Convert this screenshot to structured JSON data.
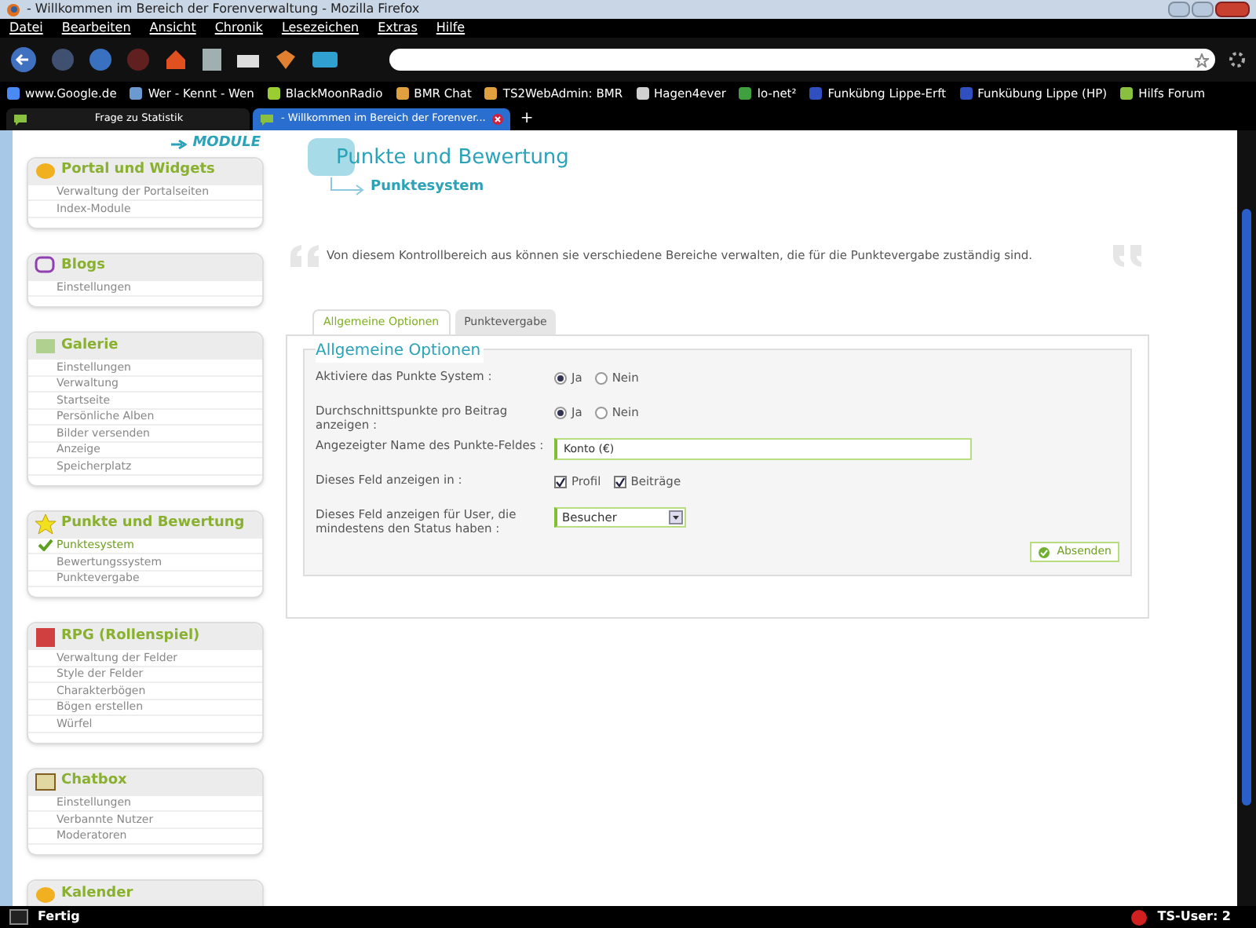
{
  "window": {
    "title": "- Willkommen im Bereich der Forenverwaltung - Mozilla Firefox"
  },
  "menu": [
    "Datei",
    "Bearbeiten",
    "Ansicht",
    "Chronik",
    "Lesezeichen",
    "Extras",
    "Hilfe"
  ],
  "bookmarks": [
    {
      "label": "www.Google.de",
      "color": "#4a8af4"
    },
    {
      "label": "Wer - Kennt - Wen",
      "color": "#6a9ad0"
    },
    {
      "label": "BlackMoonRadio",
      "color": "#9acd32"
    },
    {
      "label": "BMR Chat",
      "color": "#e0a040"
    },
    {
      "label": "TS2WebAdmin: BMR",
      "color": "#e0a040"
    },
    {
      "label": "Hagen4ever",
      "color": "#d0d0d0"
    },
    {
      "label": "lo-net²",
      "color": "#40a040"
    },
    {
      "label": "Funkübng Lippe-Erft",
      "color": "#3050c0"
    },
    {
      "label": "Funkübung Lippe (HP)",
      "color": "#3050c0"
    },
    {
      "label": "Hilfs Forum",
      "color": "#8ac040"
    }
  ],
  "tabs": [
    {
      "label": "Frage zu Statistik",
      "selected": false
    },
    {
      "label": "- Willkommen im Bereich der Forenver...",
      "selected": true
    }
  ],
  "new_tab": "+",
  "sidebar": {
    "header": "MODULE",
    "sections": [
      {
        "title": "Portal und Widgets",
        "items": [
          {
            "label": "Verwaltung der Portalseiten",
            "selected": false
          },
          {
            "label": "Index-Module",
            "selected": false
          }
        ]
      },
      {
        "title": "Blogs",
        "items": [
          {
            "label": "Einstellungen",
            "selected": false
          }
        ]
      },
      {
        "title": "Galerie",
        "items": [
          {
            "label": "Einstellungen",
            "selected": false
          },
          {
            "label": "Verwaltung",
            "selected": false
          },
          {
            "label": "Startseite",
            "selected": false
          },
          {
            "label": "Persönliche Alben",
            "selected": false
          },
          {
            "label": "Bilder versenden",
            "selected": false
          },
          {
            "label": "Anzeige",
            "selected": false
          },
          {
            "label": "Speicherplatz",
            "selected": false
          }
        ]
      },
      {
        "title": "Punkte und Bewertung",
        "items": [
          {
            "label": "Punktesystem",
            "selected": true
          },
          {
            "label": "Bewertungssystem",
            "selected": false
          },
          {
            "label": "Punktevergabe",
            "selected": false
          }
        ]
      },
      {
        "title": "RPG (Rollenspiel)",
        "items": [
          {
            "label": "Verwaltung der Felder",
            "selected": false
          },
          {
            "label": "Style der Felder",
            "selected": false
          },
          {
            "label": "Charakterbögen",
            "selected": false
          },
          {
            "label": "Bögen erstellen",
            "selected": false
          },
          {
            "label": "Würfel",
            "selected": false
          }
        ]
      },
      {
        "title": "Chatbox",
        "items": [
          {
            "label": "Einstellungen",
            "selected": false
          },
          {
            "label": "Verbannte Nutzer",
            "selected": false
          },
          {
            "label": "Moderatoren",
            "selected": false
          }
        ]
      },
      {
        "title": "Kalender"
      }
    ]
  },
  "main": {
    "title": "Punkte und Bewertung",
    "subtitle": "Punktesystem",
    "description": "Von diesem Kontrollbereich aus können sie verschiedene Bereiche verwalten, die für die Punktevergabe zuständig sind.",
    "tabs": [
      {
        "label": "Allgemeine Optionen",
        "selected": true
      },
      {
        "label": "Punktevergabe",
        "selected": false
      }
    ],
    "legend": "Allgemeine Optionen",
    "rows": [
      {
        "kind": "radio",
        "label": "Aktiviere das Punkte System :",
        "options": [
          {
            "label": "Ja",
            "selected": true
          },
          {
            "label": "Nein",
            "selected": false
          }
        ]
      },
      {
        "kind": "radio",
        "label": "Durchschnittspunkte pro Beitrag anzeigen :",
        "options": [
          {
            "label": "Ja",
            "selected": true
          },
          {
            "label": "Nein",
            "selected": false
          }
        ]
      },
      {
        "kind": "text",
        "label": "Angezeigter Name des Punkte-Feldes :",
        "value": "Konto (€)"
      },
      {
        "kind": "checkbox",
        "label": "Dieses Feld anzeigen in :",
        "options": [
          {
            "label": "Profil",
            "checked": true
          },
          {
            "label": "Beiträge",
            "checked": true
          }
        ]
      },
      {
        "kind": "select",
        "label": "Dieses Feld anzeigen für User, die mindestens den Status haben :",
        "value": "Besucher"
      }
    ],
    "submit": "Absenden"
  },
  "status_bar": {
    "text": "Fertig",
    "users": "TS-User: 2"
  }
}
